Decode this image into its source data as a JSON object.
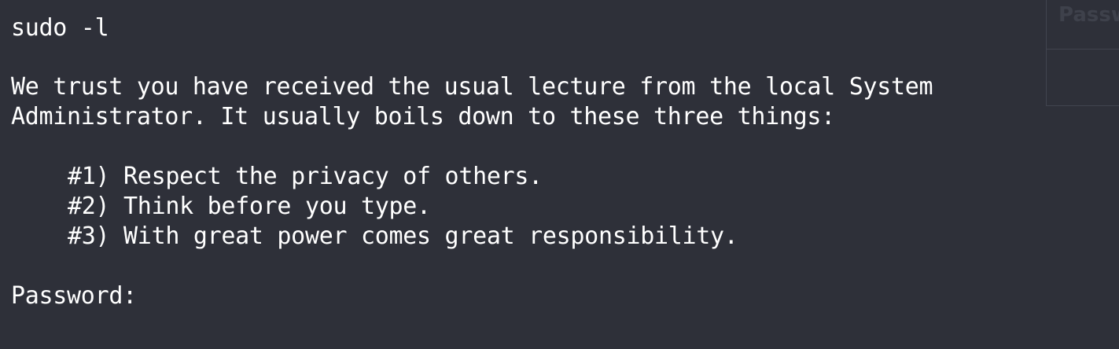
{
  "terminal": {
    "command": "sudo -l",
    "lecture_line_1": "We trust you have received the usual lecture from the local System",
    "lecture_line_2": "Administrator. It usually boils down to these three things:",
    "rules": [
      "#1) Respect the privacy of others.",
      "#2) Think before you type.",
      "#3) With great power comes great responsibility."
    ],
    "prompt": "Password:"
  },
  "side_panel": {
    "ghost_text": "Passw"
  },
  "colors": {
    "background": "#2e3039",
    "text": "#ffffff",
    "panel_border": "#41444f",
    "ghost_text": "#3e414b"
  }
}
